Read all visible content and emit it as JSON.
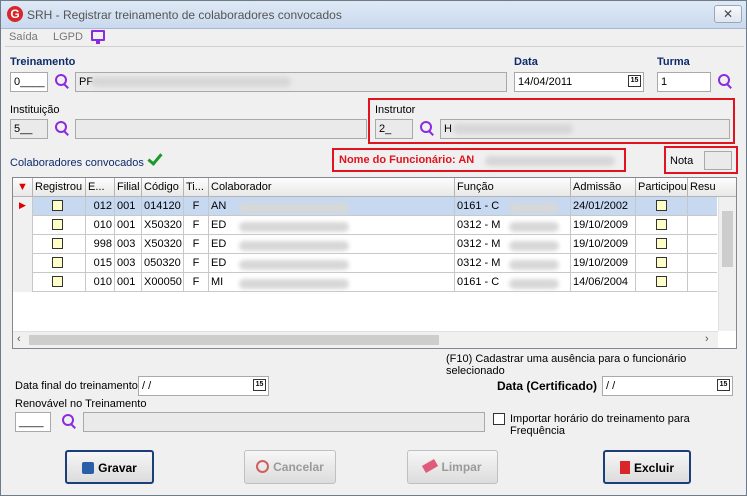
{
  "window": {
    "title": "SRH - Registrar treinamento de colaboradores convocados",
    "close": "✕"
  },
  "menu": {
    "saida": "Saída",
    "lgpd": "LGPD"
  },
  "treinamento": {
    "label": "Treinamento",
    "code": "0____",
    "name": "PF"
  },
  "data": {
    "label": "Data",
    "value": "14/04/2011"
  },
  "turma": {
    "label": "Turma",
    "value": "1"
  },
  "instituicao": {
    "label": "Instituição",
    "code": "5__"
  },
  "instrutor": {
    "label": "Instrutor",
    "code": "2_",
    "name": "H"
  },
  "colaboradores_label": "Colaboradores convocados",
  "funcionario": {
    "label": "Nome do Funcionário: AN"
  },
  "nota": {
    "label": "Nota",
    "value": ""
  },
  "grid": {
    "headers": [
      "",
      "Registrou",
      "E...",
      "Filial",
      "Código",
      "Ti...",
      "Colaborador",
      "Função",
      "Admissão",
      "Participou",
      "Resu"
    ],
    "rows": [
      {
        "e": "012",
        "filial": "001",
        "codigo": "014120",
        "ti": "F",
        "colaborador": "AN",
        "funcao": "0161 - C",
        "admissao": "24/01/2002"
      },
      {
        "e": "010",
        "filial": "001",
        "codigo": "X50320",
        "ti": "F",
        "colaborador": "ED",
        "funcao": "0312 - M",
        "admissao": "19/10/2009"
      },
      {
        "e": "998",
        "filial": "003",
        "codigo": "X50320",
        "ti": "F",
        "colaborador": "ED",
        "funcao": "0312 - M",
        "admissao": "19/10/2009"
      },
      {
        "e": "015",
        "filial": "003",
        "codigo": "050320",
        "ti": "F",
        "colaborador": "ED",
        "funcao": "0312 - M",
        "admissao": "19/10/2009"
      },
      {
        "e": "010",
        "filial": "001",
        "codigo": "X00050",
        "ti": "F",
        "colaborador": "MI",
        "funcao": "0161 - C",
        "admissao": "14/06/2004"
      }
    ]
  },
  "hint": "(F10) Cadastrar uma ausência para o funcionário selecionado",
  "data_final": {
    "label": "Data final do treinamento",
    "value": " /  /"
  },
  "data_cert": {
    "label": "Data (Certificado)",
    "value": " /  /"
  },
  "renovavel": {
    "label": "Renovável no Treinamento",
    "code": "____"
  },
  "importar": {
    "label": "Importar horário do treinamento para Frequência"
  },
  "buttons": {
    "gravar": "Gravar",
    "cancelar": "Cancelar",
    "limpar": "Limpar",
    "excluir": "Excluir"
  },
  "colors": {
    "accent": "#8a2be2",
    "highlight": "#e0141e",
    "label_blue": "#0d2b6b"
  }
}
